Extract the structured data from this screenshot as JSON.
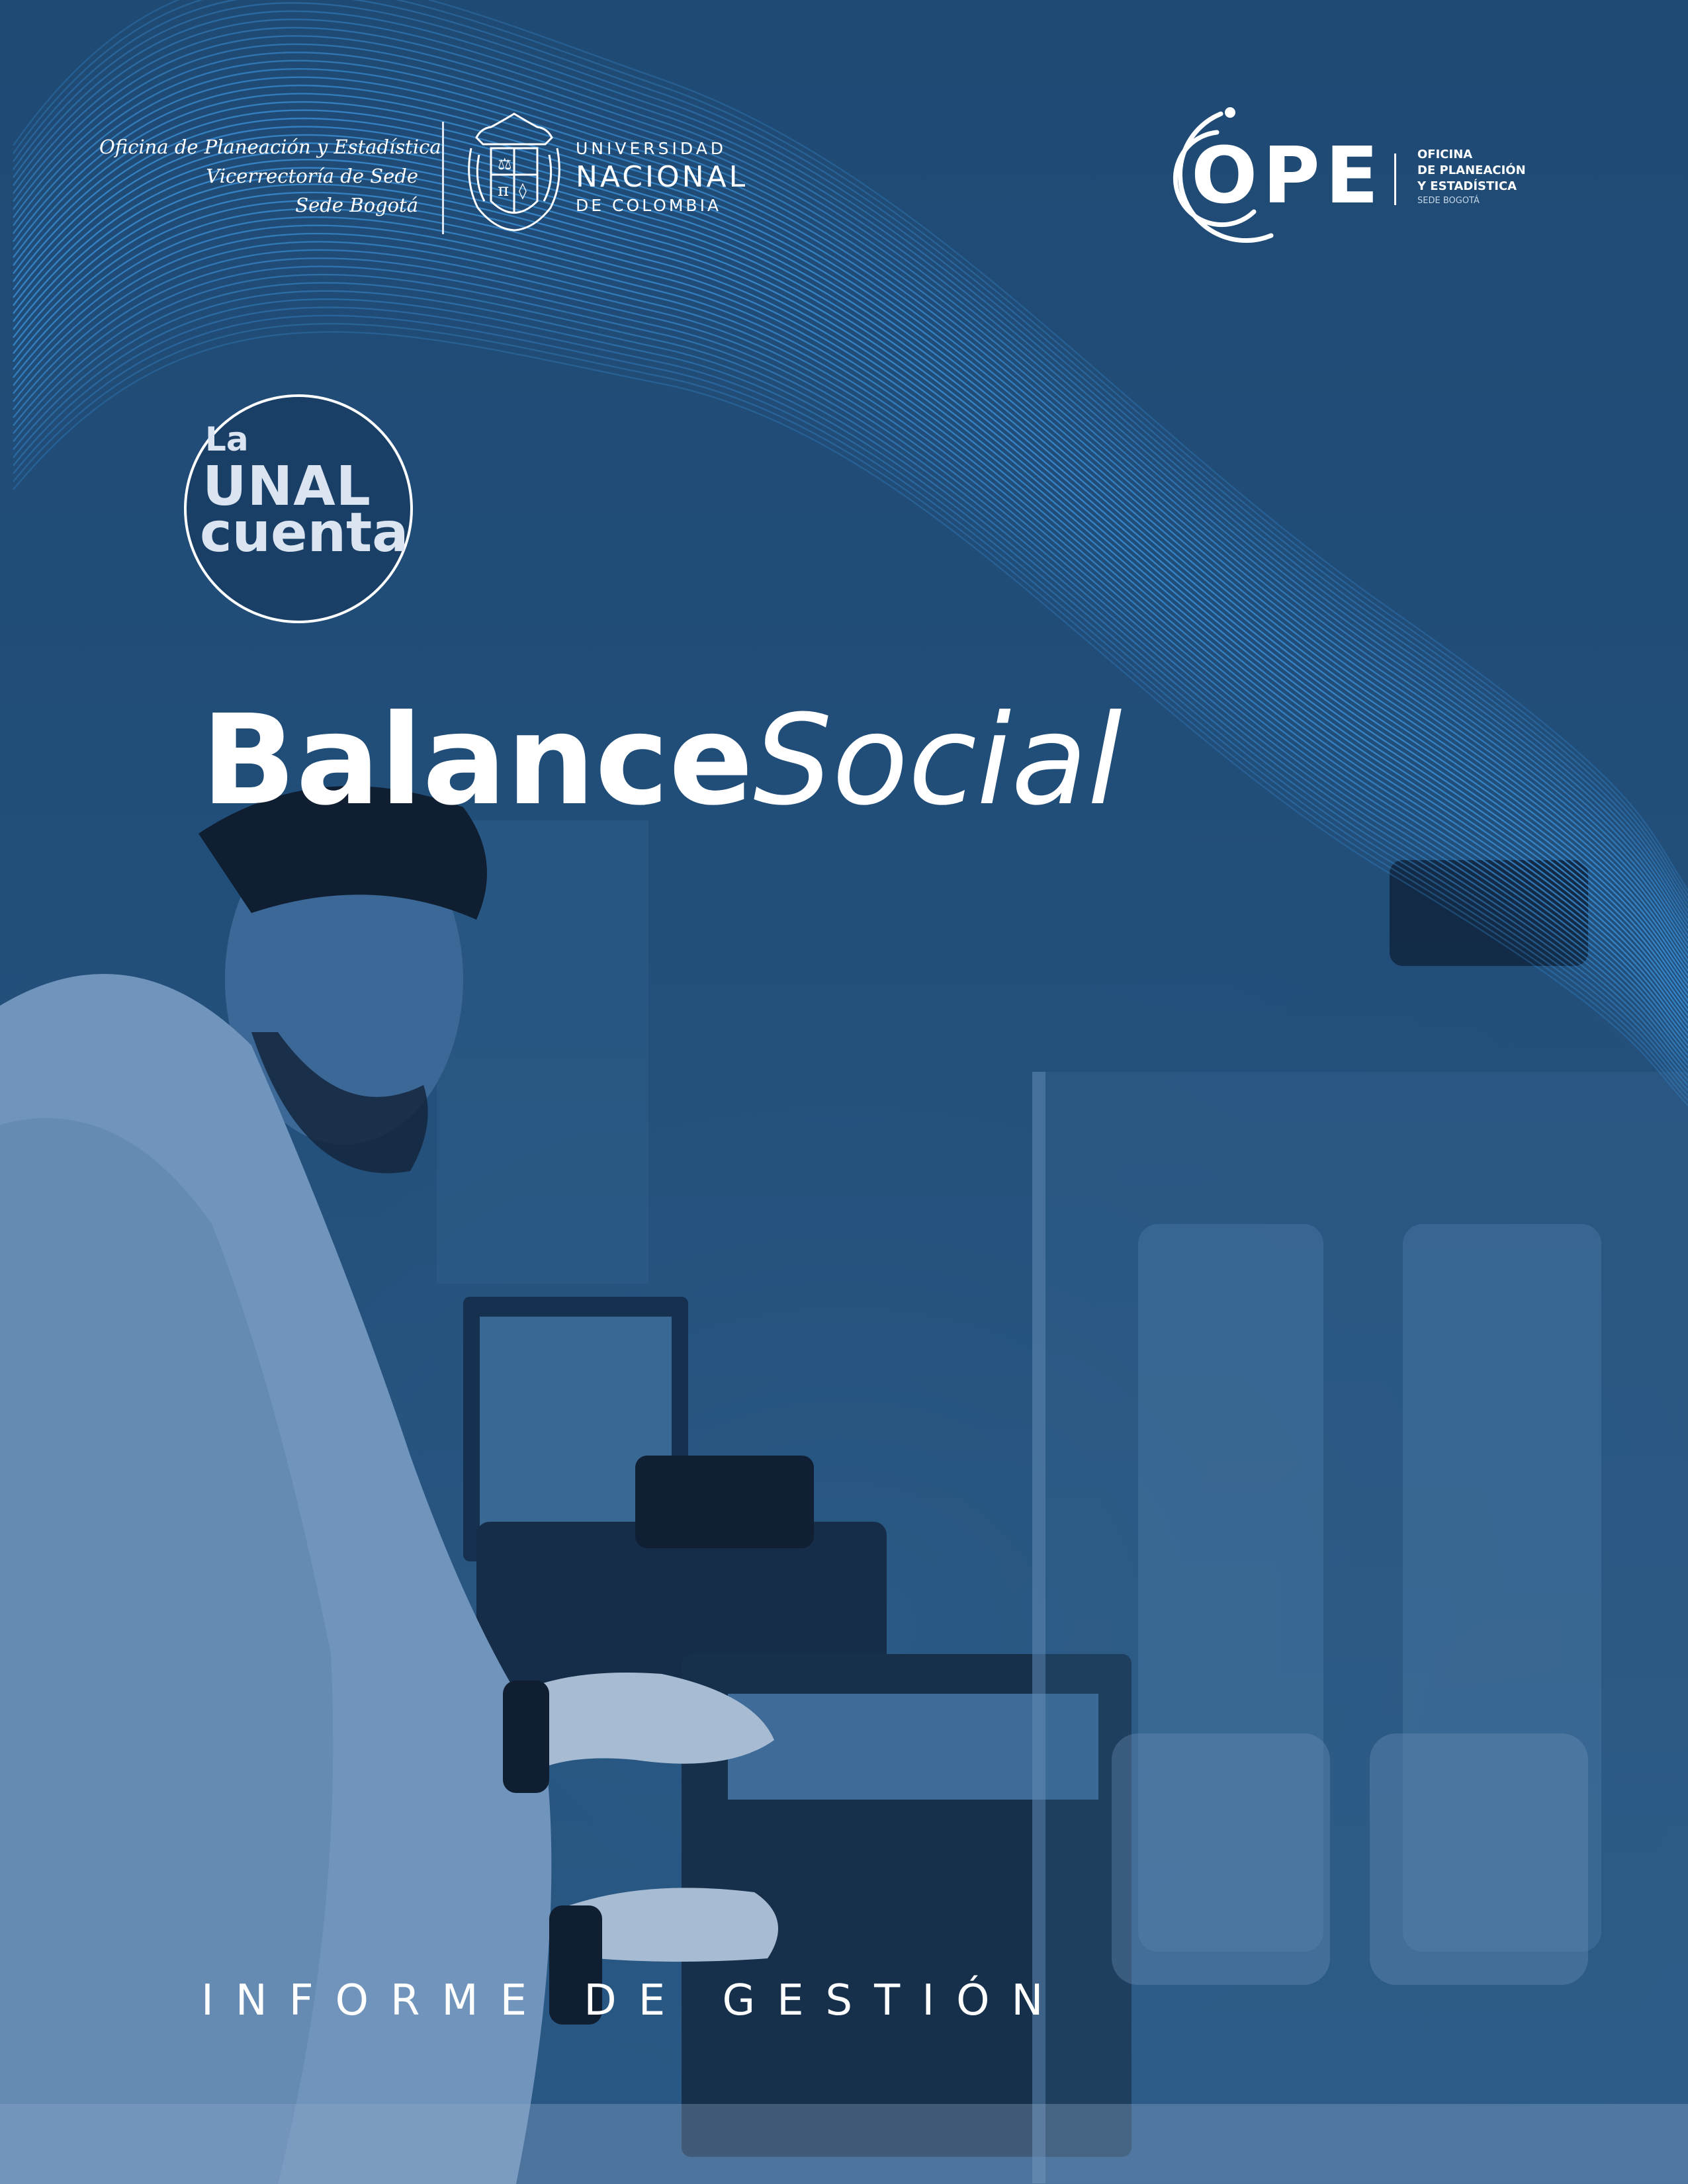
{
  "header": {
    "office_lines": [
      "Oficina de Planeación y Estadística",
      "Vicerrectoría de Sede",
      "Sede Bogotá"
    ],
    "university": {
      "line1": "UNIVERSIDAD",
      "line2": "NACIONAL",
      "line3": "DE COLOMBIA"
    },
    "ope": {
      "acronym": "OPE",
      "office_lines": [
        "OFICINA",
        "DE PLANEACIÓN",
        "Y ESTADÍSTICA"
      ],
      "sede": "SEDE BOGOTÁ"
    }
  },
  "seal": {
    "line1": "La",
    "line2": "UNAL",
    "line3": "cuenta"
  },
  "title": {
    "bold": "Balance",
    "italic": "Social"
  },
  "subtitle": "INFORME DE GESTIÓN",
  "colors": {
    "background": "#1f4a74",
    "waves": "#3a8fd6",
    "text": "#ffffff"
  },
  "icons": {
    "university_crest": "unal-crest-icon",
    "ope_logo": "ope-logo-icon"
  }
}
